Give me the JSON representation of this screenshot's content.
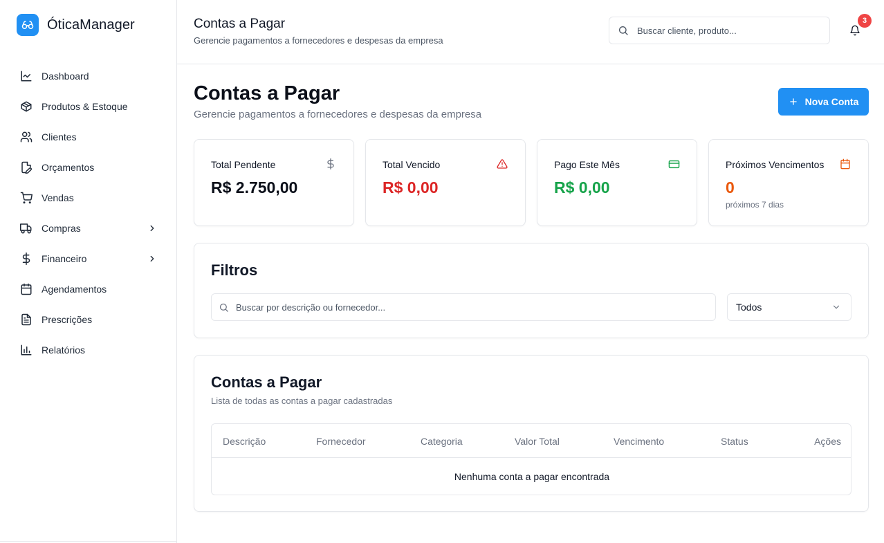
{
  "app": {
    "name": "ÓticaManager",
    "logo_icon": "glasses-icon",
    "accent": "#2190f3"
  },
  "sidebar": {
    "items": [
      {
        "label": "Dashboard",
        "icon": "chart-line-icon"
      },
      {
        "label": "Produtos & Estoque",
        "icon": "package-icon"
      },
      {
        "label": "Clientes",
        "icon": "users-icon"
      },
      {
        "label": "Orçamentos",
        "icon": "file-edit-icon"
      },
      {
        "label": "Vendas",
        "icon": "cart-icon"
      },
      {
        "label": "Compras",
        "icon": "truck-icon",
        "has_submenu": true
      },
      {
        "label": "Financeiro",
        "icon": "dollar-icon",
        "has_submenu": true
      },
      {
        "label": "Agendamentos",
        "icon": "calendar-icon"
      },
      {
        "label": "Prescrições",
        "icon": "file-text-icon"
      },
      {
        "label": "Relatórios",
        "icon": "bar-chart-icon"
      }
    ]
  },
  "header": {
    "title": "Contas a Pagar",
    "subtitle": "Gerencie pagamentos a fornecedores e despesas da empresa",
    "search_placeholder": "Buscar cliente, produto...",
    "notification_count": "3"
  },
  "page": {
    "title": "Contas a Pagar",
    "subtitle": "Gerencie pagamentos a fornecedores e despesas da empresa",
    "new_button_label": "Nova Conta"
  },
  "stats": [
    {
      "label": "Total Pendente",
      "value": "R$ 2.750,00",
      "icon": "dollar-icon",
      "color": "#0b0f19"
    },
    {
      "label": "Total Vencido",
      "value": "R$ 0,00",
      "icon": "alert-triangle-icon",
      "color": "#dc2626"
    },
    {
      "label": "Pago Este Mês",
      "value": "R$ 0,00",
      "icon": "credit-card-icon",
      "color": "#16a34a"
    },
    {
      "label": "Próximos Vencimentos",
      "value": "0",
      "note": "próximos 7 dias",
      "icon": "calendar-icon",
      "color": "#ea580c"
    }
  ],
  "filters": {
    "title": "Filtros",
    "search_placeholder": "Buscar por descrição ou fornecedor...",
    "status_selected": "Todos"
  },
  "table": {
    "title": "Contas a Pagar",
    "subtitle": "Lista de todas as contas a pagar cadastradas",
    "columns": [
      "Descrição",
      "Fornecedor",
      "Categoria",
      "Valor Total",
      "Vencimento",
      "Status",
      "Ações"
    ],
    "empty_message": "Nenhuma conta a pagar encontrada"
  }
}
